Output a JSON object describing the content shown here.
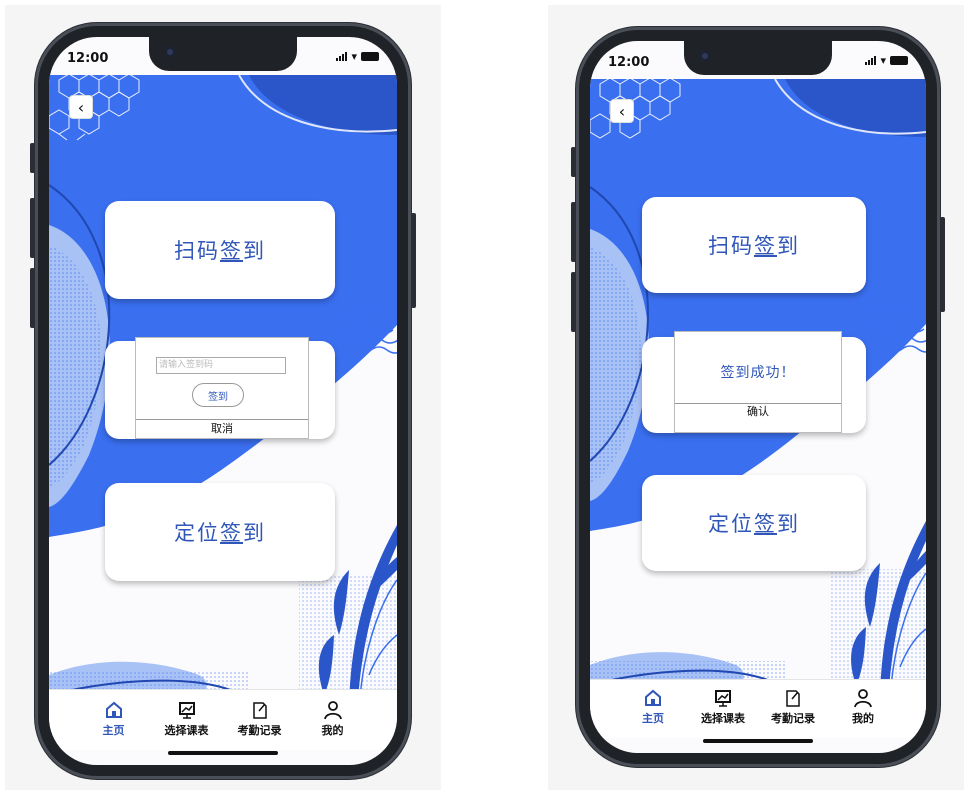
{
  "status_bar": {
    "time": "12:00"
  },
  "screens": [
    {
      "cards": [
        {
          "label_plain": "扫码",
          "label_underlined": "签",
          "label_rest": "到"
        },
        {
          "label_plain": "定位",
          "label_underlined": "签",
          "label_rest": "到"
        }
      ],
      "dialog": {
        "input_placeholder": "请输入签到码",
        "submit_label": "签到",
        "cancel_label": "取消"
      }
    },
    {
      "cards": [
        {
          "label_plain": "扫码",
          "label_underlined": "签",
          "label_rest": "到"
        },
        {
          "label_plain": "定位",
          "label_underlined": "签",
          "label_rest": "到"
        }
      ],
      "dialog": {
        "message": "签到成功！",
        "confirm_label": "确认"
      }
    }
  ],
  "tabbar": {
    "items": [
      {
        "label": "主页",
        "icon": "home-icon",
        "active": true
      },
      {
        "label": "选择课表",
        "icon": "board-icon",
        "active": false
      },
      {
        "label": "考勤记录",
        "icon": "notepad-icon",
        "active": false
      },
      {
        "label": "我的",
        "icon": "user-icon",
        "active": false
      }
    ]
  },
  "colors": {
    "primary": "#2f56b8",
    "blob": "#3a6ff0",
    "blob_light": "#a9c2f6"
  }
}
